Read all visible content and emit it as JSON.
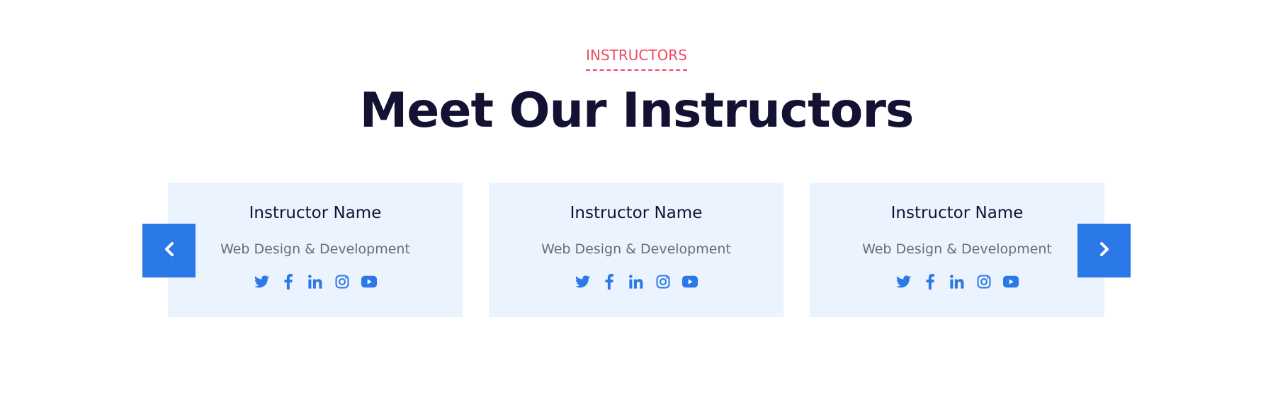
{
  "section": {
    "eyebrow": "INSTRUCTORS",
    "heading": "Meet Our Instructors"
  },
  "colors": {
    "accent": "#ee4a62",
    "primary": "#2b78e8",
    "heading": "#141233",
    "card_bg": "#ebf3fe",
    "muted_text": "#6b6b7b"
  },
  "instructors": [
    {
      "name": "Instructor Name",
      "role": "Web Design & Development",
      "socials": [
        "twitter-icon",
        "facebook-icon",
        "linkedin-icon",
        "instagram-icon",
        "youtube-icon"
      ]
    },
    {
      "name": "Instructor Name",
      "role": "Web Design & Development",
      "socials": [
        "twitter-icon",
        "facebook-icon",
        "linkedin-icon",
        "instagram-icon",
        "youtube-icon"
      ]
    },
    {
      "name": "Instructor Name",
      "role": "Web Design & Development",
      "socials": [
        "twitter-icon",
        "facebook-icon",
        "linkedin-icon",
        "instagram-icon",
        "youtube-icon"
      ]
    }
  ],
  "carousel": {
    "prev_icon": "chevron-left-icon",
    "next_icon": "chevron-right-icon"
  }
}
